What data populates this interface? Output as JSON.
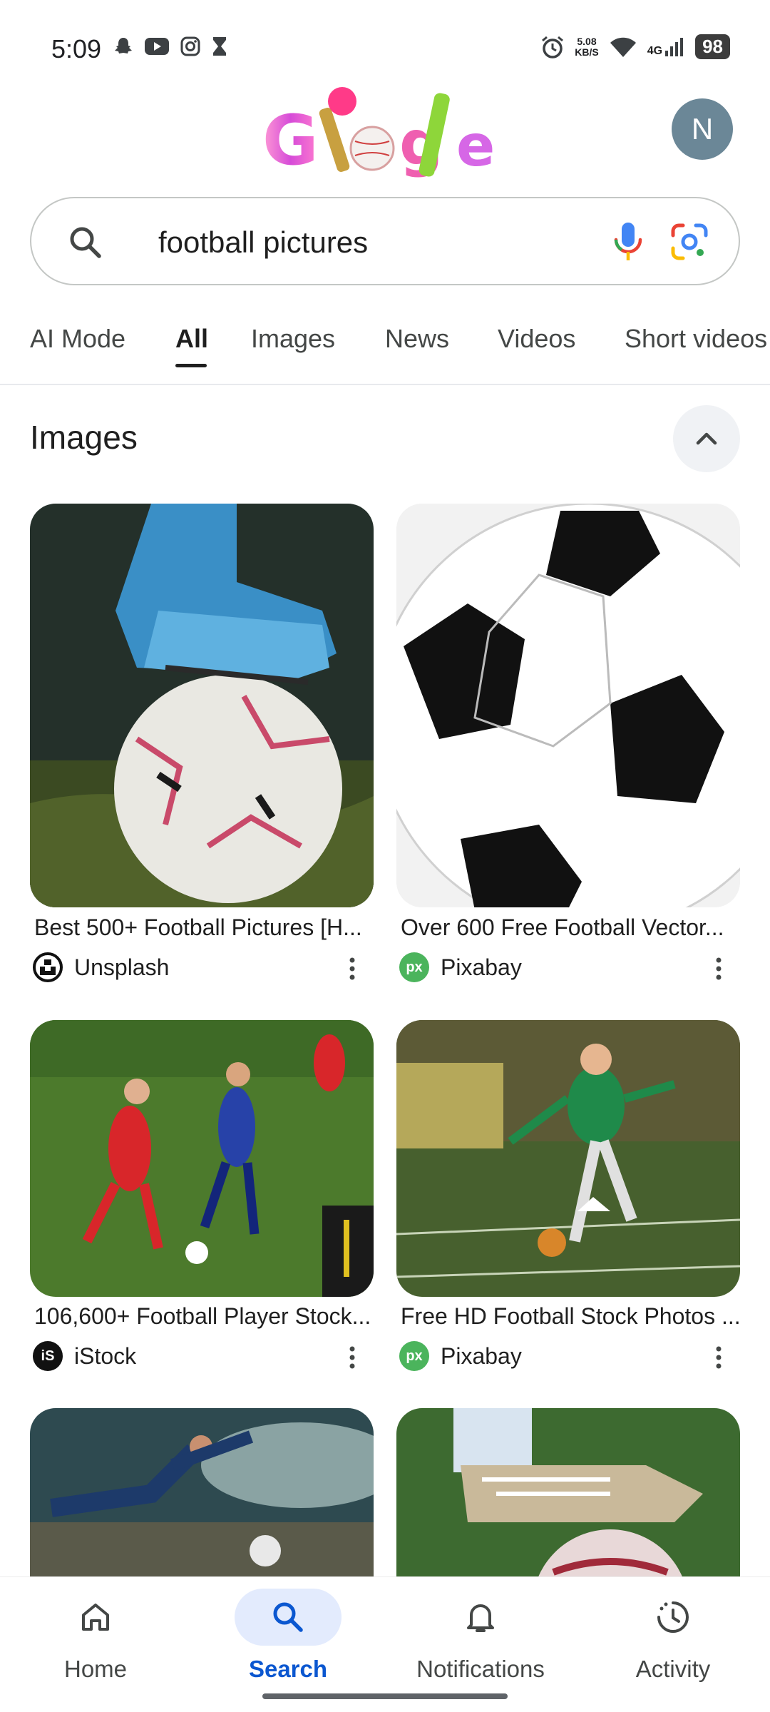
{
  "status_bar": {
    "time": "5:09",
    "net_speed_value": "5.08",
    "net_speed_unit": "KB/S",
    "network": "4G",
    "battery": "98"
  },
  "header": {
    "logo": "Google",
    "avatar_initial": "N"
  },
  "search": {
    "query": "football pictures"
  },
  "tabs": [
    {
      "label": "AI Mode",
      "active": false
    },
    {
      "label": "All",
      "active": true
    },
    {
      "label": "Images",
      "active": false
    },
    {
      "label": "News",
      "active": false
    },
    {
      "label": "Videos",
      "active": false
    },
    {
      "label": "Short videos",
      "active": false
    }
  ],
  "images_section": {
    "title": "Images",
    "results": [
      {
        "caption": "Best 500+ Football Pictures [H...",
        "source": "Unsplash"
      },
      {
        "caption": "Over 600 Free Football Vector...",
        "source": "Pixabay"
      },
      {
        "caption": "106,600+ Football Player Stock...",
        "source": "iStock"
      },
      {
        "caption": "Free HD Football Stock Photos ...",
        "source": "Pixabay"
      }
    ]
  },
  "bottom_nav": [
    {
      "label": "Home",
      "active": false
    },
    {
      "label": "Search",
      "active": true
    },
    {
      "label": "Notifications",
      "active": false
    },
    {
      "label": "Activity",
      "active": false
    }
  ],
  "colors": {
    "accent": "#0b57d0",
    "active_nav_bg": "#e3ebfd",
    "avatar_bg": "#6b8797"
  }
}
